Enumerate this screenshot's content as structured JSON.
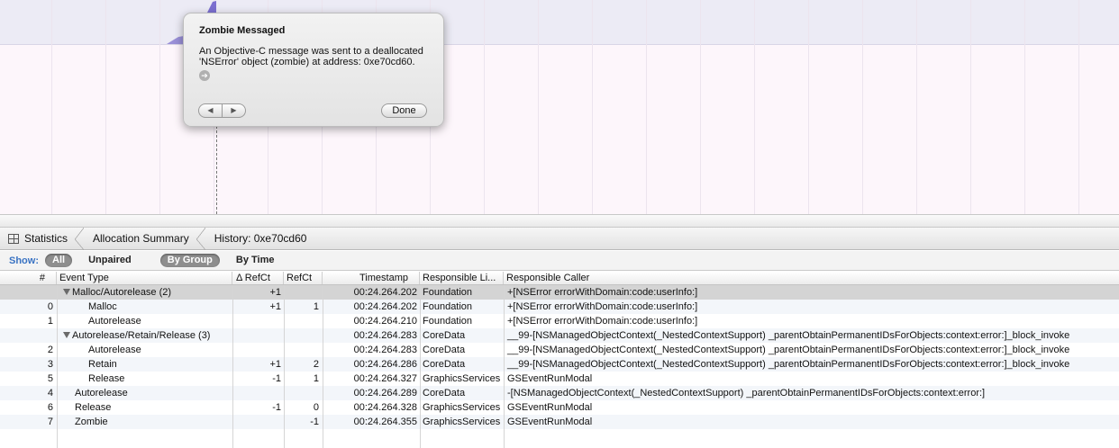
{
  "popover": {
    "title": "Zombie Messaged",
    "message": "An Objective-C message was sent to a deallocated 'NSError' object (zombie) at address: 0xe70cd60.",
    "go_icon": "arrow-right-circle-icon",
    "prev_icon": "◀",
    "next_icon": "▶",
    "done_label": "Done"
  },
  "jumpbar": {
    "items": [
      "Statistics",
      "Allocation Summary",
      "History: 0xe70cd60"
    ]
  },
  "scopebar": {
    "show_label": "Show:",
    "filter_all": "All",
    "filter_unpaired": "Unpaired",
    "group_by_group": "By Group",
    "group_by_time": "By Time"
  },
  "table": {
    "columns": [
      "#",
      "Event Type",
      "Δ RefCt",
      "RefCt",
      "Timestamp",
      "Responsible Li...",
      "Responsible Caller"
    ],
    "rows": [
      {
        "num": "",
        "type": "Malloc/Autorelease (2)",
        "group": true,
        "indent": 0,
        "dref": "+1",
        "ref": "",
        "ts": "00:24.264.202",
        "lib": "Foundation",
        "caller": "+[NSError errorWithDomain:code:userInfo:]"
      },
      {
        "num": "0",
        "type": "Malloc",
        "group": false,
        "indent": 2,
        "dref": "+1",
        "ref": "1",
        "ts": "00:24.264.202",
        "lib": "Foundation",
        "caller": "+[NSError errorWithDomain:code:userInfo:]"
      },
      {
        "num": "1",
        "type": "Autorelease",
        "group": false,
        "indent": 2,
        "dref": "",
        "ref": "",
        "ts": "00:24.264.210",
        "lib": "Foundation",
        "caller": "+[NSError errorWithDomain:code:userInfo:]"
      },
      {
        "num": "",
        "type": "Autorelease/Retain/Release (3)",
        "group": true,
        "indent": 0,
        "dref": "",
        "ref": "",
        "ts": "00:24.264.283",
        "lib": "CoreData",
        "caller": "__99-[NSManagedObjectContext(_NestedContextSupport) _parentObtainPermanentIDsForObjects:context:error:]_block_invoke"
      },
      {
        "num": "2",
        "type": "Autorelease",
        "group": false,
        "indent": 2,
        "dref": "",
        "ref": "",
        "ts": "00:24.264.283",
        "lib": "CoreData",
        "caller": "__99-[NSManagedObjectContext(_NestedContextSupport) _parentObtainPermanentIDsForObjects:context:error:]_block_invoke"
      },
      {
        "num": "3",
        "type": "Retain",
        "group": false,
        "indent": 2,
        "dref": "+1",
        "ref": "2",
        "ts": "00:24.264.286",
        "lib": "CoreData",
        "caller": "__99-[NSManagedObjectContext(_NestedContextSupport) _parentObtainPermanentIDsForObjects:context:error:]_block_invoke"
      },
      {
        "num": "5",
        "type": "Release",
        "group": false,
        "indent": 2,
        "dref": "-1",
        "ref": "1",
        "ts": "00:24.264.327",
        "lib": "GraphicsServices",
        "caller": "GSEventRunModal"
      },
      {
        "num": "4",
        "type": "Autorelease",
        "group": false,
        "indent": 1,
        "dref": "",
        "ref": "",
        "ts": "00:24.264.289",
        "lib": "CoreData",
        "caller": "-[NSManagedObjectContext(_NestedContextSupport) _parentObtainPermanentIDsForObjects:context:error:]"
      },
      {
        "num": "6",
        "type": "Release",
        "group": false,
        "indent": 1,
        "dref": "-1",
        "ref": "0",
        "ts": "00:24.264.328",
        "lib": "GraphicsServices",
        "caller": "GSEventRunModal"
      },
      {
        "num": "7",
        "type": "Zombie",
        "group": false,
        "indent": 1,
        "dref": "",
        "ref": "-1",
        "ts": "00:24.264.355",
        "lib": "GraphicsServices",
        "caller": "GSEventRunModal"
      }
    ]
  }
}
